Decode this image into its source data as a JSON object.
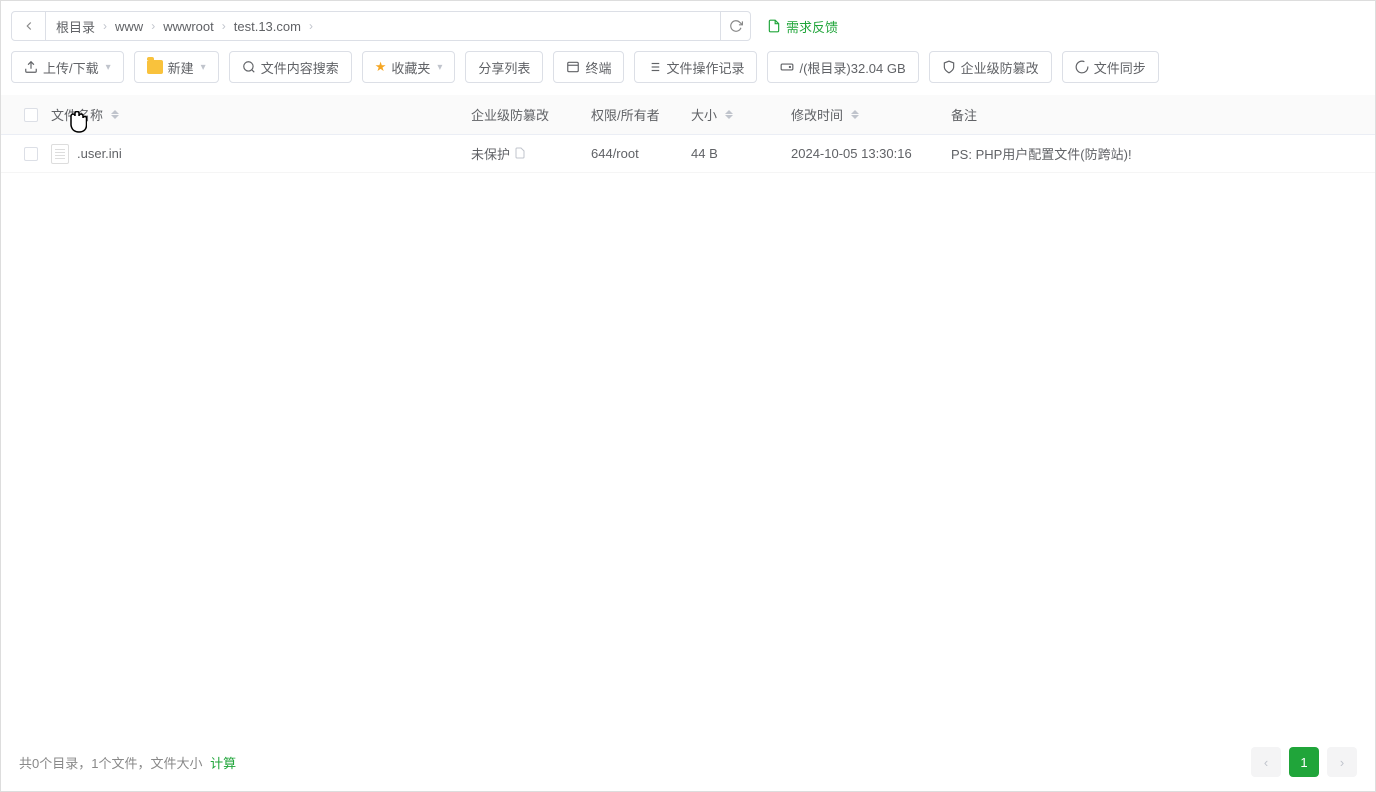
{
  "breadcrumb": {
    "items": [
      "根目录",
      "www",
      "wwwroot",
      "test.13.com"
    ]
  },
  "feedback": {
    "label": "需求反馈"
  },
  "toolbar": {
    "upload_download": "上传/下载",
    "new": "新建",
    "content_search": "文件内容搜索",
    "favorites": "收藏夹",
    "share_list": "分享列表",
    "terminal": "终端",
    "operation_log": "文件操作记录",
    "disk_root": "/(根目录)32.04 GB",
    "enterprise_protect": "企业级防篡改",
    "file_sync": "文件同步"
  },
  "table": {
    "headers": {
      "name": "文件名称",
      "protect": "企业级防篡改",
      "permission": "权限/所有者",
      "size": "大小",
      "mtime": "修改时间",
      "remark": "备注"
    },
    "rows": [
      {
        "name": ".user.ini",
        "protect": "未保护",
        "permission": "644/root",
        "size": "44 B",
        "mtime": "2024-10-05 13:30:16",
        "remark": "PS: PHP用户配置文件(防跨站)!"
      }
    ]
  },
  "footer": {
    "summary": "共0个目录，1个文件，文件大小",
    "calc": "计算"
  },
  "pagination": {
    "current": "1"
  }
}
